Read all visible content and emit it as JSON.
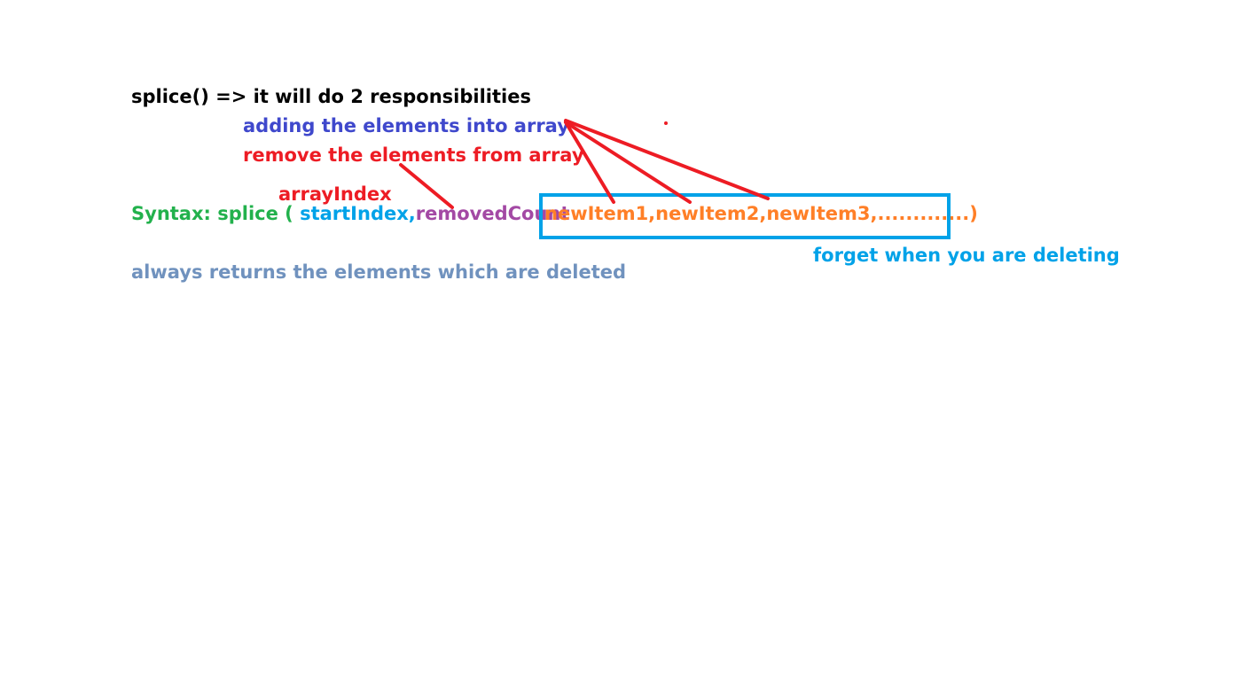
{
  "notes": {
    "line1": "splice()  => it will do 2 responsibilities",
    "line2": "adding the elements into array",
    "line3": "remove the elements from array",
    "annotation_array_index": "arrayIndex",
    "syntax": {
      "prefix": "Syntax: splice ( ",
      "start_index": "startIndex,",
      "removed_count": "removedCount",
      "new_items": "newItem1,newItem2,newItem3,.............",
      "close_paren": ")"
    },
    "annotation_forget": "forget when you are deleting",
    "returns_note": "always returns the elements which are deleted"
  },
  "colors": {
    "black": "#000000",
    "blue": "#3f48cc",
    "red": "#ed1c24",
    "green": "#22b14c",
    "cyan": "#00a2e8",
    "purple": "#a349a4",
    "orange": "#ff7f27",
    "slate": "#7092be"
  }
}
